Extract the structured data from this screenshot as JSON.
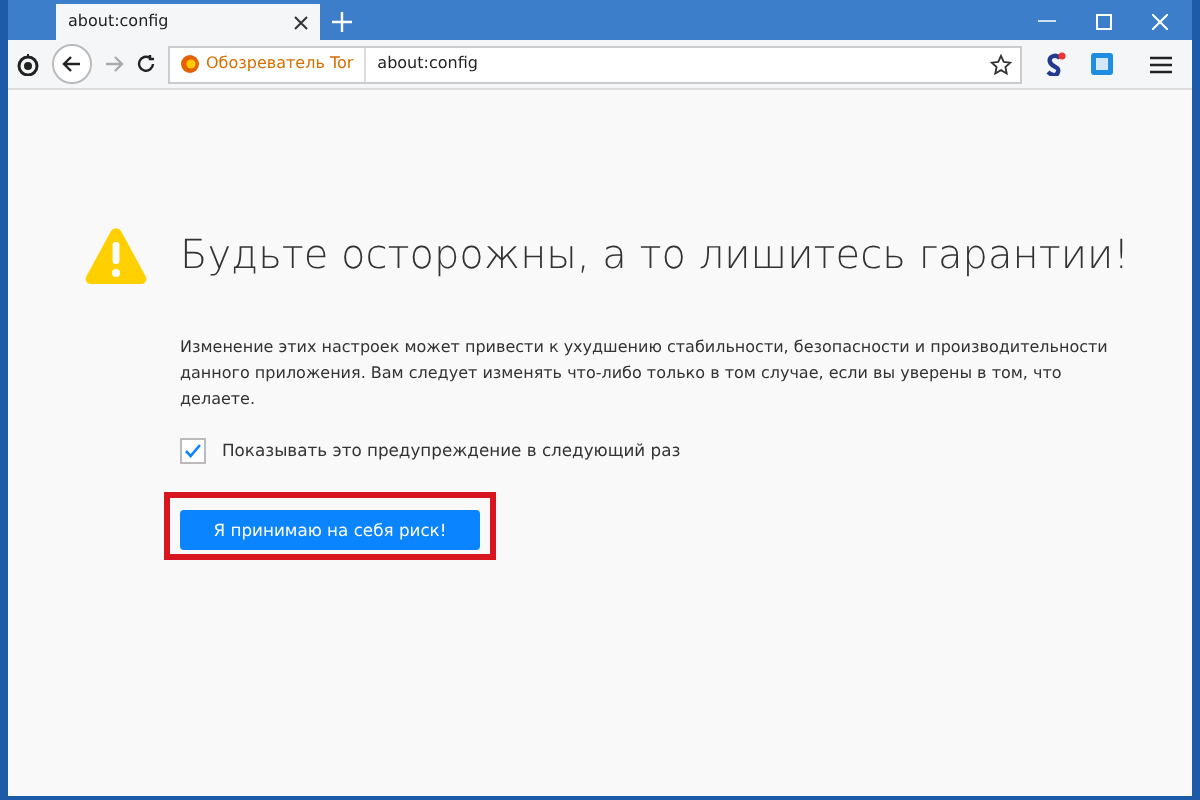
{
  "tabs": [
    {
      "label": "about:config",
      "selected": true
    }
  ],
  "address_bar": {
    "identity": "Обозреватель Tor",
    "url": "about:config"
  },
  "warning": {
    "heading": "Будьте осторожны, а то лишитесь гарантии!",
    "text": "Изменение этих настроек может привести к ухудшению стабильности, безопасности и производительности данного приложения. Вам следует изменять что-либо только в том случае, если вы уверены в том, что делаете.",
    "checkbox": {
      "label": "Показывать это предупреждение в следующий раз",
      "checked": true
    },
    "button": {
      "label": "Я принимаю на себя риск!",
      "highlighted": true
    }
  }
}
